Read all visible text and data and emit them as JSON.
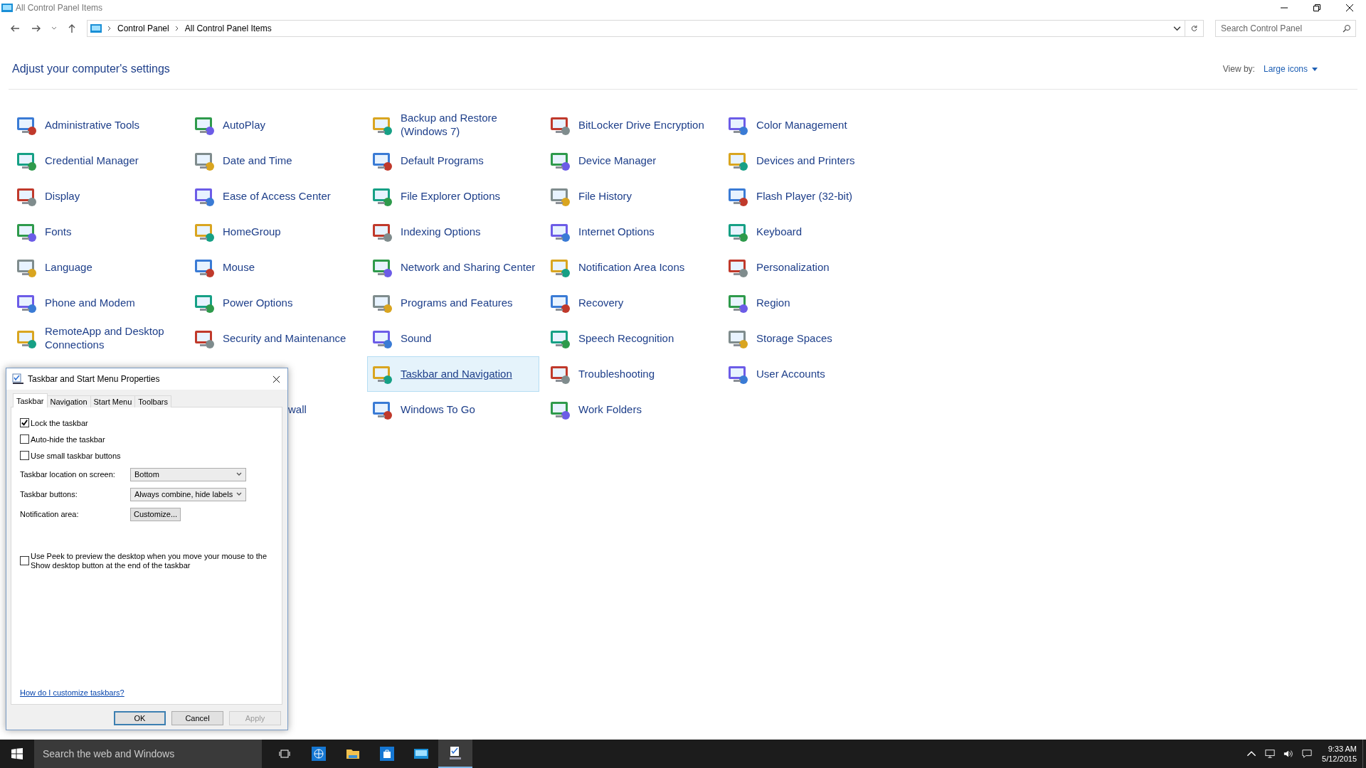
{
  "window": {
    "title": "All Control Panel Items"
  },
  "address_bar": {
    "breadcrumbs": [
      "Control Panel",
      "All Control Panel Items"
    ]
  },
  "search": {
    "placeholder": "Search Control Panel"
  },
  "header": {
    "title": "Adjust your computer's settings",
    "view_by_label": "View by:",
    "view_by_value": "Large icons"
  },
  "items": [
    {
      "kind": "item",
      "label": "Administrative Tools",
      "selected": false
    },
    {
      "kind": "item",
      "label": "AutoPlay",
      "selected": false
    },
    {
      "kind": "item",
      "label": "Backup and Restore (Windows 7)",
      "selected": false
    },
    {
      "kind": "item",
      "label": "BitLocker Drive Encryption",
      "selected": false
    },
    {
      "kind": "item",
      "label": "Color Management",
      "selected": false
    },
    {
      "kind": "item",
      "label": "Credential Manager",
      "selected": false
    },
    {
      "kind": "item",
      "label": "Date and Time",
      "selected": false
    },
    {
      "kind": "item",
      "label": "Default Programs",
      "selected": false
    },
    {
      "kind": "item",
      "label": "Device Manager",
      "selected": false
    },
    {
      "kind": "item",
      "label": "Devices and Printers",
      "selected": false
    },
    {
      "kind": "item",
      "label": "Display",
      "selected": false
    },
    {
      "kind": "item",
      "label": "Ease of Access Center",
      "selected": false
    },
    {
      "kind": "item",
      "label": "File Explorer Options",
      "selected": false
    },
    {
      "kind": "item",
      "label": "File History",
      "selected": false
    },
    {
      "kind": "item",
      "label": "Flash Player (32-bit)",
      "selected": false
    },
    {
      "kind": "item",
      "label": "Fonts",
      "selected": false
    },
    {
      "kind": "item",
      "label": "HomeGroup",
      "selected": false
    },
    {
      "kind": "item",
      "label": "Indexing Options",
      "selected": false
    },
    {
      "kind": "item",
      "label": "Internet Options",
      "selected": false
    },
    {
      "kind": "item",
      "label": "Keyboard",
      "selected": false
    },
    {
      "kind": "item",
      "label": "Language",
      "selected": false
    },
    {
      "kind": "item",
      "label": "Mouse",
      "selected": false
    },
    {
      "kind": "item",
      "label": "Network and Sharing Center",
      "selected": false
    },
    {
      "kind": "item",
      "label": "Notification Area Icons",
      "selected": false
    },
    {
      "kind": "item",
      "label": "Personalization",
      "selected": false
    },
    {
      "kind": "item",
      "label": "Phone and Modem",
      "selected": false
    },
    {
      "kind": "item",
      "label": "Power Options",
      "selected": false
    },
    {
      "kind": "item",
      "label": "Programs and Features",
      "selected": false
    },
    {
      "kind": "item",
      "label": "Recovery",
      "selected": false
    },
    {
      "kind": "item",
      "label": "Region",
      "selected": false
    },
    {
      "kind": "item",
      "label": "RemoteApp and Desktop Connections",
      "selected": false
    },
    {
      "kind": "item",
      "label": "Security and Maintenance",
      "selected": false
    },
    {
      "kind": "item",
      "label": "Sound",
      "selected": false
    },
    {
      "kind": "item",
      "label": "Speech Recognition",
      "selected": false
    },
    {
      "kind": "item",
      "label": "Storage Spaces",
      "selected": false
    },
    {
      "kind": "covered"
    },
    {
      "kind": "covered"
    },
    {
      "kind": "item",
      "label": "Taskbar and Navigation",
      "selected": true
    },
    {
      "kind": "item",
      "label": "Troubleshooting",
      "selected": false
    },
    {
      "kind": "item",
      "label": "User Accounts",
      "selected": false
    },
    {
      "kind": "covered"
    },
    {
      "kind": "cut",
      "label": "wall"
    },
    {
      "kind": "item",
      "label": "Windows To Go",
      "selected": false
    },
    {
      "kind": "item",
      "label": "Work Folders",
      "selected": false
    }
  ],
  "dialog": {
    "title": "Taskbar and Start Menu Properties",
    "tabs": [
      {
        "label": "Taskbar",
        "selected": true
      },
      {
        "label": "Navigation",
        "selected": false
      },
      {
        "label": "Start Menu",
        "selected": false
      },
      {
        "label": "Toolbars",
        "selected": false
      }
    ],
    "checkboxes": [
      {
        "label": "Lock the taskbar",
        "checked": true
      },
      {
        "label": "Auto-hide the taskbar",
        "checked": false
      },
      {
        "label": "Use small taskbar buttons",
        "checked": false
      }
    ],
    "settings": [
      {
        "kind": "dropdown",
        "label": "Taskbar location on screen:",
        "value": "Bottom"
      },
      {
        "kind": "dropdown",
        "label": "Taskbar buttons:",
        "value": "Always combine, hide labels"
      },
      {
        "kind": "button",
        "label": "Notification area:",
        "value": "Customize..."
      }
    ],
    "peek": {
      "label": "Use Peek to preview the desktop when you move your mouse to the Show desktop button at the end of the taskbar",
      "checked": false
    },
    "help_link": "How do I customize taskbars?",
    "buttons": [
      {
        "label": "OK",
        "default": true,
        "disabled": false
      },
      {
        "label": "Cancel",
        "default": false,
        "disabled": false
      },
      {
        "label": "Apply",
        "default": false,
        "disabled": true
      }
    ]
  },
  "taskbar": {
    "search_placeholder": "Search the web and Windows",
    "apps": [
      {
        "kind": "taskview",
        "active": false
      },
      {
        "kind": "browser",
        "active": false
      },
      {
        "kind": "explorer",
        "active": false
      },
      {
        "kind": "store",
        "active": false
      },
      {
        "kind": "controlpanel",
        "active": false
      },
      {
        "kind": "properties",
        "active": true
      }
    ],
    "time": "9:33 AM",
    "date": "5/12/2015"
  }
}
